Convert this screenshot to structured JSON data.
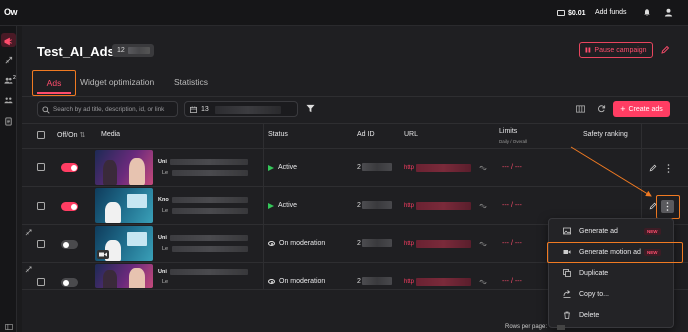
{
  "topbar": {
    "logo": "Ow",
    "balance": "$0.01",
    "add_funds": "Add funds",
    "icons": [
      "wallet-icon",
      "bell-icon",
      "user-icon"
    ]
  },
  "sidebar": {
    "badge": "2",
    "icons": [
      "megaphone-icon",
      "rocket-icon",
      "users-icon",
      "audience-icon",
      "document-icon",
      "collapse-icon"
    ]
  },
  "page": {
    "title": "Test_AI_Ads",
    "count_prefix": "12",
    "pause_label": "Pause campaign",
    "tabs": [
      "Ads",
      "Widget optimization",
      "Statistics"
    ],
    "active_tab": "Ads"
  },
  "toolbar": {
    "search_placeholder": "Search by ad title, description, id, or link",
    "date_prefix": "13",
    "create_label": "Create ads"
  },
  "table": {
    "headers": {
      "onoff": "Off/On",
      "media": "Media",
      "status": "Status",
      "adid": "Ad ID",
      "url": "URL",
      "limits": "Limits",
      "limits_sub": "Daily / Overall",
      "safety": "Safety ranking"
    },
    "rows": [
      {
        "on": true,
        "title": "Uni",
        "sub": "Le",
        "status": "Active",
        "status_kind": "active",
        "adid": "2",
        "url": "http",
        "limits": "--- / ---",
        "moderation_icon": false
      },
      {
        "on": true,
        "title": "Kno",
        "sub": "Le",
        "status": "Active",
        "status_kind": "active",
        "adid": "2",
        "url": "http",
        "limits": "--- / ---",
        "moderation_icon": false
      },
      {
        "on": false,
        "title": "Uni",
        "sub": "Le",
        "status": "On moderation",
        "status_kind": "moderation",
        "adid": "2",
        "url": "http",
        "limits": "--- / ---",
        "moderation_icon": true
      },
      {
        "on": false,
        "title": "Uni",
        "sub": "Le",
        "status": "On moderation",
        "status_kind": "moderation",
        "adid": "2",
        "url": "http",
        "limits": "--- / ---",
        "moderation_icon": true
      }
    ]
  },
  "context_menu": {
    "items": [
      {
        "label": "Generate ad",
        "badge": "NEW",
        "icon": "image-icon"
      },
      {
        "label": "Generate motion ad",
        "badge": "NEW",
        "icon": "video-icon"
      },
      {
        "label": "Duplicate",
        "badge": "",
        "icon": "duplicate-icon"
      },
      {
        "label": "Copy to...",
        "badge": "",
        "icon": "copy-to-icon"
      },
      {
        "label": "Delete",
        "badge": "",
        "icon": "trash-icon"
      }
    ],
    "highlighted": "Generate motion ad"
  },
  "footer": {
    "rows_per_page": "Rows per page:"
  },
  "colors": {
    "accent": "#ff3d63",
    "highlight_outline": "#f07a22",
    "active_status": "#34c759"
  }
}
